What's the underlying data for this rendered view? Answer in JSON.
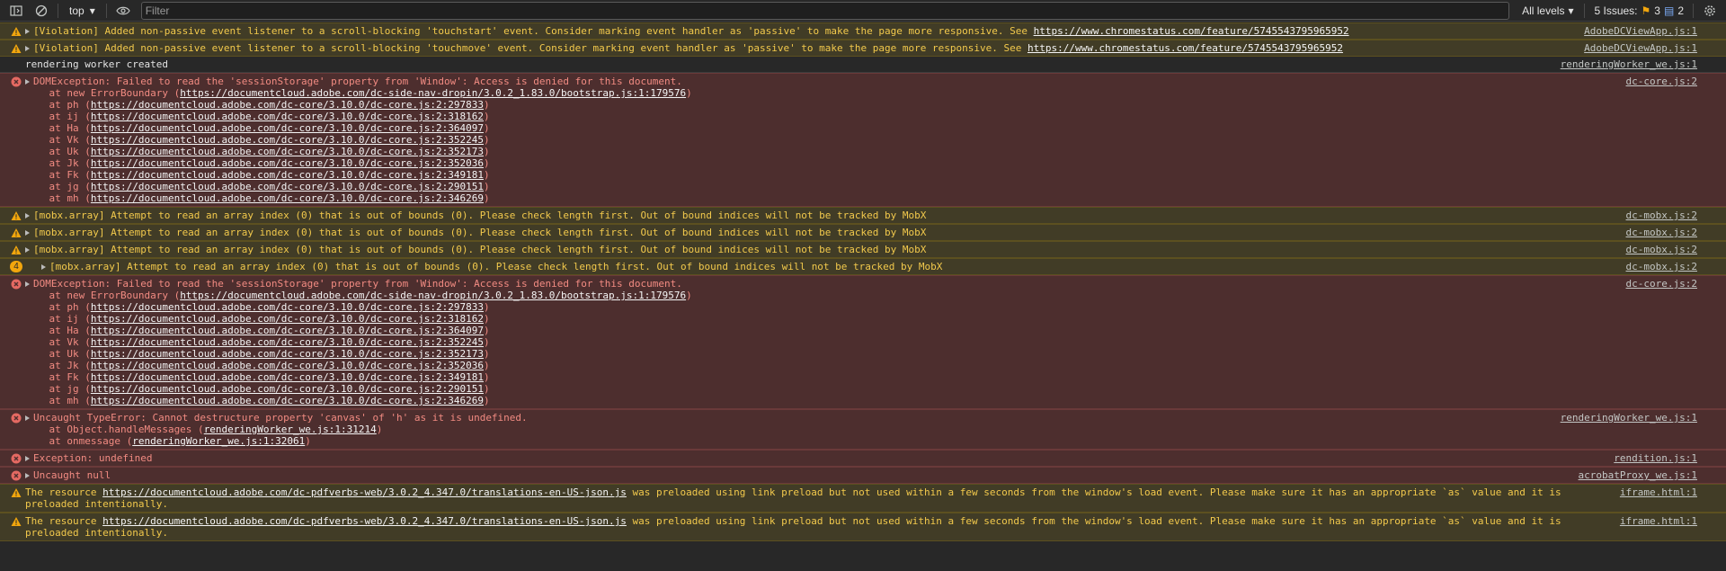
{
  "toolbar": {
    "context": "top",
    "filter_placeholder": "Filter",
    "levels": "All levels",
    "issues_label": "5 Issues:",
    "issues_warn": "3",
    "issues_info": "2"
  },
  "rows": [
    {
      "type": "warn",
      "text": "[Violation] Added non-passive event listener to a scroll-blocking 'touchstart' event. Consider marking event handler as 'passive' to make the page more responsive. See ",
      "link": "https://www.chromestatus.com/feature/5745543795965952",
      "source": "AdobeDCViewApp.js:1"
    },
    {
      "type": "warn",
      "text": "[Violation] Added non-passive event listener to a scroll-blocking 'touchmove' event. Consider marking event handler as 'passive' to make the page more responsive. See ",
      "link": "https://www.chromestatus.com/feature/5745543795965952",
      "source": "AdobeDCViewApp.js:1"
    },
    {
      "type": "info",
      "text": "rendering worker created",
      "source": "renderingWorker_we.js:1"
    },
    {
      "type": "error",
      "text": "DOMException: Failed to read the 'sessionStorage' property from 'Window': Access is denied for this document.",
      "source": "dc-core.js:2",
      "stack": [
        {
          "pre": "at new ErrorBoundary (",
          "link": "https://documentcloud.adobe.com/dc-side-nav-dropin/3.0.2_1.83.0/bootstrap.js:1:179576"
        },
        {
          "pre": "at ph (",
          "link": "https://documentcloud.adobe.com/dc-core/3.10.0/dc-core.js:2:297833"
        },
        {
          "pre": "at ij (",
          "link": "https://documentcloud.adobe.com/dc-core/3.10.0/dc-core.js:2:318162"
        },
        {
          "pre": "at Ha (",
          "link": "https://documentcloud.adobe.com/dc-core/3.10.0/dc-core.js:2:364097"
        },
        {
          "pre": "at Vk (",
          "link": "https://documentcloud.adobe.com/dc-core/3.10.0/dc-core.js:2:352245"
        },
        {
          "pre": "at Uk (",
          "link": "https://documentcloud.adobe.com/dc-core/3.10.0/dc-core.js:2:352173"
        },
        {
          "pre": "at Jk (",
          "link": "https://documentcloud.adobe.com/dc-core/3.10.0/dc-core.js:2:352036"
        },
        {
          "pre": "at Fk (",
          "link": "https://documentcloud.adobe.com/dc-core/3.10.0/dc-core.js:2:349181"
        },
        {
          "pre": "at jg (",
          "link": "https://documentcloud.adobe.com/dc-core/3.10.0/dc-core.js:2:290151"
        },
        {
          "pre": "at mh (",
          "link": "https://documentcloud.adobe.com/dc-core/3.10.0/dc-core.js:2:346269"
        }
      ]
    },
    {
      "type": "warn",
      "text": "[mobx.array] Attempt to read an array index (0) that is out of bounds (0). Please check length first. Out of bound indices will not be tracked by MobX",
      "source": "dc-mobx.js:2"
    },
    {
      "type": "warn",
      "text": "[mobx.array] Attempt to read an array index (0) that is out of bounds (0). Please check length first. Out of bound indices will not be tracked by MobX",
      "source": "dc-mobx.js:2"
    },
    {
      "type": "warn",
      "text": "[mobx.array] Attempt to read an array index (0) that is out of bounds (0). Please check length first. Out of bound indices will not be tracked by MobX",
      "source": "dc-mobx.js:2"
    },
    {
      "type": "warn",
      "repeat": "4",
      "text": "[mobx.array] Attempt to read an array index (0) that is out of bounds (0). Please check length first. Out of bound indices will not be tracked by MobX",
      "source": "dc-mobx.js:2"
    },
    {
      "type": "error",
      "text": "DOMException: Failed to read the 'sessionStorage' property from 'Window': Access is denied for this document.",
      "source": "dc-core.js:2",
      "stack": [
        {
          "pre": "at new ErrorBoundary (",
          "link": "https://documentcloud.adobe.com/dc-side-nav-dropin/3.0.2_1.83.0/bootstrap.js:1:179576"
        },
        {
          "pre": "at ph (",
          "link": "https://documentcloud.adobe.com/dc-core/3.10.0/dc-core.js:2:297833"
        },
        {
          "pre": "at ij (",
          "link": "https://documentcloud.adobe.com/dc-core/3.10.0/dc-core.js:2:318162"
        },
        {
          "pre": "at Ha (",
          "link": "https://documentcloud.adobe.com/dc-core/3.10.0/dc-core.js:2:364097"
        },
        {
          "pre": "at Vk (",
          "link": "https://documentcloud.adobe.com/dc-core/3.10.0/dc-core.js:2:352245"
        },
        {
          "pre": "at Uk (",
          "link": "https://documentcloud.adobe.com/dc-core/3.10.0/dc-core.js:2:352173"
        },
        {
          "pre": "at Jk (",
          "link": "https://documentcloud.adobe.com/dc-core/3.10.0/dc-core.js:2:352036"
        },
        {
          "pre": "at Fk (",
          "link": "https://documentcloud.adobe.com/dc-core/3.10.0/dc-core.js:2:349181"
        },
        {
          "pre": "at jg (",
          "link": "https://documentcloud.adobe.com/dc-core/3.10.0/dc-core.js:2:290151"
        },
        {
          "pre": "at mh (",
          "link": "https://documentcloud.adobe.com/dc-core/3.10.0/dc-core.js:2:346269"
        }
      ]
    },
    {
      "type": "error",
      "text": "Uncaught TypeError: Cannot destructure property 'canvas' of 'h' as it is undefined.",
      "source": "renderingWorker_we.js:1",
      "stack": [
        {
          "pre": "at Object.handleMessages (",
          "link": "renderingWorker_we.js:1:31214"
        },
        {
          "pre": "at onmessage (",
          "link": "renderingWorker_we.js:1:32061"
        }
      ]
    },
    {
      "type": "error",
      "text": "Exception: undefined",
      "source": "rendition.js:1"
    },
    {
      "type": "error",
      "text": "Uncaught null",
      "source": "acrobatProxy_we.js:1"
    },
    {
      "type": "warn",
      "noexpand": true,
      "text": "The resource ",
      "link": "https://documentcloud.adobe.com/dc-pdfverbs-web/3.0.2_4.347.0/translations-en-US-json.js",
      "after": " was preloaded using link preload but not used within a few seconds from the window's load event. Please make sure it has an appropriate `as` value and it is\npreloaded intentionally.",
      "source": "iframe.html:1"
    },
    {
      "type": "warn",
      "noexpand": true,
      "text": "The resource ",
      "link": "https://documentcloud.adobe.com/dc-pdfverbs-web/3.0.2_4.347.0/translations-en-US-json.js",
      "after": " was preloaded using link preload but not used within a few seconds from the window's load event. Please make sure it has an appropriate `as` value and it is\npreloaded intentionally.",
      "source": "iframe.html:1"
    }
  ],
  "colors": {
    "warn": "#f2c94c",
    "error": "#f28b82",
    "bg": "#282828"
  }
}
